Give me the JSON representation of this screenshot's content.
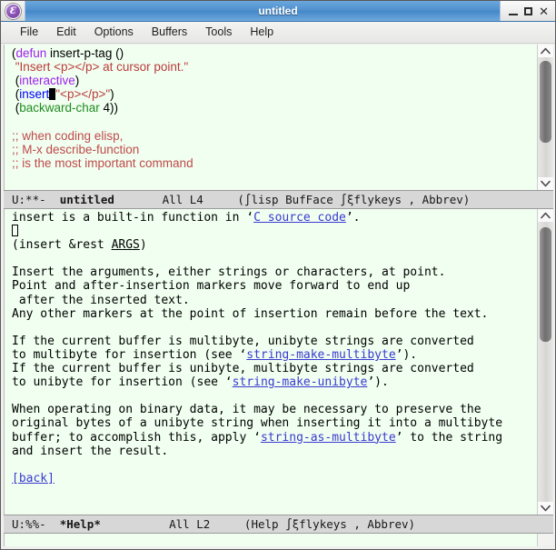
{
  "titlebar": {
    "app_icon": "emacs-icon",
    "icon_glyph": "Ɛ",
    "title": "untitled",
    "minimize_label": "minimize",
    "maximize_label": "maximize",
    "close_glyph": "✕"
  },
  "menubar": {
    "items": [
      {
        "label": "File"
      },
      {
        "label": "Edit"
      },
      {
        "label": "Options"
      },
      {
        "label": "Buffers"
      },
      {
        "label": "Tools"
      },
      {
        "label": "Help"
      }
    ]
  },
  "code_buffer": {
    "name": "untitled",
    "lines": [
      {
        "segments": [
          {
            "text": "(",
            "cls": ""
          },
          {
            "text": "defun",
            "cls": "kw"
          },
          {
            "text": " insert-p-tag ()",
            "cls": ""
          }
        ]
      },
      {
        "segments": [
          {
            "text": " ",
            "cls": ""
          },
          {
            "text": "\"Insert <p></p> at cursor point.\"",
            "cls": "str"
          }
        ]
      },
      {
        "segments": [
          {
            "text": " (",
            "cls": ""
          },
          {
            "text": "interactive",
            "cls": "kw"
          },
          {
            "text": ")",
            "cls": ""
          }
        ]
      },
      {
        "segments": [
          {
            "text": " (",
            "cls": ""
          },
          {
            "text": "insert",
            "cls": "fn"
          },
          {
            "text": "▊",
            "cls": "cursor"
          },
          {
            "text": "\"<p></p>\"",
            "cls": "str"
          },
          {
            "text": ")",
            "cls": ""
          }
        ]
      },
      {
        "segments": [
          {
            "text": " (",
            "cls": ""
          },
          {
            "text": "backward-char",
            "cls": "fn2"
          },
          {
            "text": " 4))",
            "cls": ""
          }
        ]
      },
      {
        "segments": [
          {
            "text": "",
            "cls": ""
          }
        ]
      },
      {
        "segments": [
          {
            "text": ";; when coding elisp,",
            "cls": "cmt"
          }
        ]
      },
      {
        "segments": [
          {
            "text": ";; M-x describe-function",
            "cls": "cmt"
          }
        ]
      },
      {
        "segments": [
          {
            "text": ";; is the most important command",
            "cls": "cmt"
          }
        ]
      }
    ]
  },
  "code_modeline": {
    "encoding": "U:**-",
    "buffer_name": "untitled",
    "position": "All L4",
    "modes": "(∫lisp BufFace ∫ξflykeys , Abbrev)",
    "full": "U:**-  untitled       All L4     (∫lisp BufFace ∫ξflykeys , Abbrev)"
  },
  "help_buffer": {
    "name": "*Help*",
    "lines": [
      {
        "segments": [
          {
            "text": "insert is a built-in function in ‘",
            "cls": ""
          },
          {
            "text": "C source code",
            "cls": "link"
          },
          {
            "text": "’.",
            "cls": ""
          }
        ]
      },
      {
        "segments": [
          {
            "text": "⎕",
            "cls": "cursor-hollow"
          }
        ]
      },
      {
        "segments": [
          {
            "text": "(insert &rest ",
            "cls": ""
          },
          {
            "text": "ARGS",
            "cls": "ul"
          },
          {
            "text": ")",
            "cls": ""
          }
        ]
      },
      {
        "segments": [
          {
            "text": "",
            "cls": ""
          }
        ]
      },
      {
        "segments": [
          {
            "text": "Insert the arguments, either strings or characters, at point.",
            "cls": ""
          }
        ]
      },
      {
        "segments": [
          {
            "text": "Point and after-insertion markers move forward to end up",
            "cls": ""
          }
        ]
      },
      {
        "segments": [
          {
            "text": " after the inserted text.",
            "cls": ""
          }
        ]
      },
      {
        "segments": [
          {
            "text": "Any other markers at the point of insertion remain before the text.",
            "cls": ""
          }
        ]
      },
      {
        "segments": [
          {
            "text": "",
            "cls": ""
          }
        ]
      },
      {
        "segments": [
          {
            "text": "If the current buffer is multibyte, unibyte strings are converted",
            "cls": ""
          }
        ]
      },
      {
        "segments": [
          {
            "text": "to multibyte for insertion (see ‘",
            "cls": ""
          },
          {
            "text": "string-make-multibyte",
            "cls": "link"
          },
          {
            "text": "’).",
            "cls": ""
          }
        ]
      },
      {
        "segments": [
          {
            "text": "If the current buffer is unibyte, multibyte strings are converted",
            "cls": ""
          }
        ]
      },
      {
        "segments": [
          {
            "text": "to unibyte for insertion (see ‘",
            "cls": ""
          },
          {
            "text": "string-make-unibyte",
            "cls": "link"
          },
          {
            "text": "’).",
            "cls": ""
          }
        ]
      },
      {
        "segments": [
          {
            "text": "",
            "cls": ""
          }
        ]
      },
      {
        "segments": [
          {
            "text": "When operating on binary data, it may be necessary to preserve the",
            "cls": ""
          }
        ]
      },
      {
        "segments": [
          {
            "text": "original bytes of a unibyte string when inserting it into a multibyte",
            "cls": ""
          }
        ]
      },
      {
        "segments": [
          {
            "text": "buffer; to accomplish this, apply ‘",
            "cls": ""
          },
          {
            "text": "string-as-multibyte",
            "cls": "link"
          },
          {
            "text": "’ to the string",
            "cls": ""
          }
        ]
      },
      {
        "segments": [
          {
            "text": "and insert the result.",
            "cls": ""
          }
        ]
      },
      {
        "segments": [
          {
            "text": "",
            "cls": ""
          }
        ]
      },
      {
        "segments": [
          {
            "text": "[back]",
            "cls": "link"
          }
        ]
      }
    ]
  },
  "help_modeline": {
    "encoding": "U:%%-",
    "buffer_name": "*Help*",
    "position": "All L2",
    "modes": "(Help ∫ξflykeys , Abbrev)",
    "full": "U:%%-  *Help*          All L2     (Help ∫ξflykeys , Abbrev)"
  },
  "scrollbars": {
    "top": {
      "up_icon": "chevron-up-icon",
      "down_icon": "chevron-down-icon",
      "thumb_top_pct": 3,
      "thumb_height_pct": 68
    },
    "bottom": {
      "up_icon": "chevron-up-icon",
      "down_icon": "chevron-down-icon",
      "thumb_top_pct": 2,
      "thumb_height_pct": 41
    }
  },
  "colors": {
    "buffer_bg": "#f0fff0",
    "modeline_bg": "#d7d7d7",
    "keyword": "#a020f0",
    "function": "#0000ff",
    "function2": "#228b22",
    "string": "#bc3b3b",
    "comment": "#c04a4a",
    "link": "#3a3ad0",
    "titlebar": "#4e8fcd"
  }
}
